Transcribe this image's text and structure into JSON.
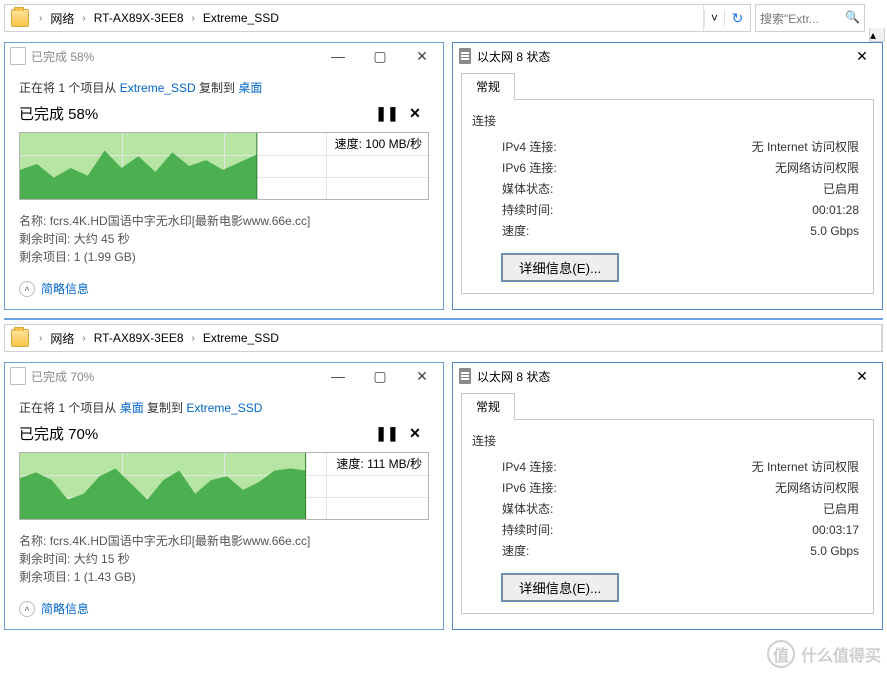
{
  "addr1": {
    "crumbs": [
      "网络",
      "RT-AX89X-3EE8",
      "Extreme_SSD"
    ],
    "search_placeholder": "搜索\"Extr..."
  },
  "addr2": {
    "crumbs": [
      "网络",
      "RT-AX89X-3EE8",
      "Extreme_SSD"
    ]
  },
  "copy1": {
    "title": "已完成 58%",
    "line_pre": "正在将 1 个项目从 ",
    "src": "Extreme_SSD",
    "mid": " 复制到 ",
    "dst": "桌面",
    "progress": "已完成 58%",
    "speed_label": "速度: 100 MB/秒",
    "name_label": "名称:",
    "name_val": "fcrs.4K.HD国语中字无水印[最新电影www.66e.cc]",
    "remain_label": "剩余时间:",
    "remain_val": "大约 45 秒",
    "items_label": "剩余项目:",
    "items_val": "1 (1.99 GB)",
    "brief": "简略信息",
    "done_pct": 58
  },
  "copy2": {
    "title": "已完成 70%",
    "line_pre": "正在将 1 个项目从 ",
    "src": "桌面",
    "mid": " 复制到 ",
    "dst": "Extreme_SSD",
    "progress": "已完成 70%",
    "speed_label": "速度: 111 MB/秒",
    "name_label": "名称:",
    "name_val": "fcrs.4K.HD国语中字无水印[最新电影www.66e.cc]",
    "remain_label": "剩余时间:",
    "remain_val": "大约 15 秒",
    "items_label": "剩余项目:",
    "items_val": "1 (1.43 GB)",
    "brief": "简略信息",
    "done_pct": 70
  },
  "status1": {
    "title": "以太网 8 状态",
    "tab": "常规",
    "section": "连接",
    "rows": [
      {
        "k": "IPv4 连接:",
        "v": "无 Internet 访问权限"
      },
      {
        "k": "IPv6 连接:",
        "v": "无网络访问权限"
      },
      {
        "k": "媒体状态:",
        "v": "已启用"
      },
      {
        "k": "持续时间:",
        "v": "00:01:28"
      },
      {
        "k": "速度:",
        "v": "5.0 Gbps"
      }
    ],
    "details_btn": "详细信息(E)..."
  },
  "status2": {
    "title": "以太网 8 状态",
    "tab": "常规",
    "section": "连接",
    "rows": [
      {
        "k": "IPv4 连接:",
        "v": "无 Internet 访问权限"
      },
      {
        "k": "IPv6 连接:",
        "v": "无网络访问权限"
      },
      {
        "k": "媒体状态:",
        "v": "已启用"
      },
      {
        "k": "持续时间:",
        "v": "00:03:17"
      },
      {
        "k": "速度:",
        "v": "5.0 Gbps"
      }
    ],
    "details_btn": "详细信息(E)..."
  },
  "watermark": "什么值得买",
  "chart_data": [
    {
      "type": "area",
      "title": "Copy speed over time (read from Extreme_SSD)",
      "ylabel": "MB/秒",
      "ylim": [
        0,
        150
      ],
      "x": [
        0,
        1,
        2,
        3,
        4,
        5,
        6,
        7,
        8,
        9,
        10,
        11,
        12,
        13,
        14
      ],
      "values": [
        70,
        78,
        58,
        72,
        60,
        92,
        70,
        85,
        65,
        90,
        72,
        80,
        68,
        78,
        100
      ],
      "progress_pct": 58
    },
    {
      "type": "area",
      "title": "Copy speed over time (write to Extreme_SSD)",
      "ylabel": "MB/秒",
      "ylim": [
        0,
        150
      ],
      "x": [
        0,
        1,
        2,
        3,
        4,
        5,
        6,
        7,
        8,
        9,
        10,
        11,
        12,
        13,
        14,
        15,
        16,
        17
      ],
      "values": [
        98,
        105,
        95,
        60,
        70,
        100,
        112,
        85,
        60,
        95,
        108,
        70,
        95,
        100,
        78,
        92,
        108,
        111
      ],
      "progress_pct": 70
    }
  ]
}
